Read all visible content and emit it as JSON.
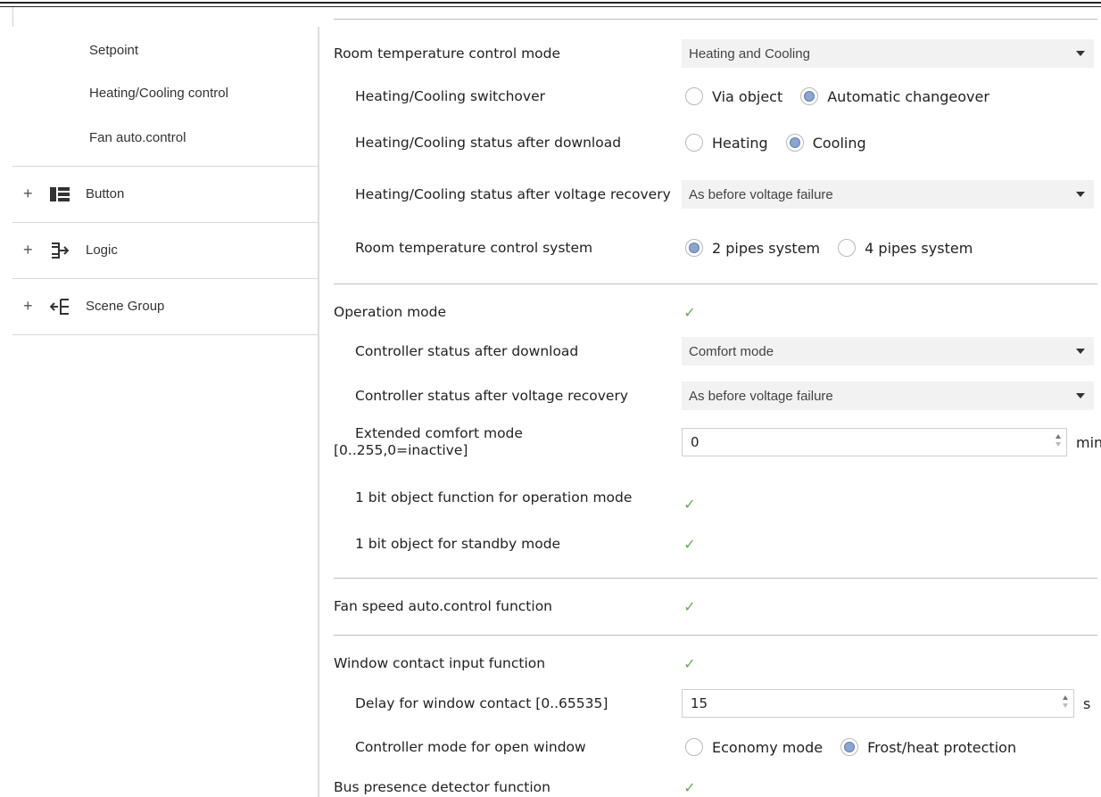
{
  "sidebar": {
    "sub_items": [
      "Setpoint",
      "Heating/Cooling control",
      "Fan auto.control"
    ],
    "groups": [
      {
        "label": "Button",
        "expander": "+",
        "icon": "button-icon"
      },
      {
        "label": "Logic",
        "expander": "+",
        "icon": "logic-icon"
      },
      {
        "label": "Scene Group",
        "expander": "+",
        "icon": "scene-group-icon"
      }
    ]
  },
  "main": {
    "room_mode": {
      "label": "Room temperature control mode",
      "value": "Heating and Cooling"
    },
    "switchover": {
      "label": "Heating/Cooling switchover",
      "opt1": "Via object",
      "opt2": "Automatic changeover",
      "selected": 2
    },
    "status_download": {
      "label": "Heating/Cooling status after download",
      "opt1": "Heating",
      "opt2": "Cooling",
      "selected": 2
    },
    "status_voltage": {
      "label": "Heating/Cooling status after voltage recovery",
      "value": "As before voltage failure"
    },
    "control_system": {
      "label": "Room temperature control system",
      "opt1": "2 pipes system",
      "opt2": "4 pipes system",
      "selected": 1
    },
    "operation_mode": {
      "label": "Operation mode",
      "checked": true
    },
    "ctrl_download": {
      "label": "Controller status after download",
      "value": "Comfort mode"
    },
    "ctrl_voltage": {
      "label": "Controller status after voltage recovery",
      "value": "As before voltage failure"
    },
    "extended_comfort": {
      "label": "Extended comfort mode [0..255,0=inactive]",
      "value": "0",
      "unit": "min"
    },
    "one_bit_op": {
      "label": "1 bit object function for operation mode",
      "checked": true
    },
    "one_bit_standby": {
      "label": "1 bit object for standby mode",
      "checked": true
    },
    "fan_speed": {
      "label": "Fan speed auto.control function",
      "checked": true
    },
    "window_contact": {
      "label": "Window contact input function",
      "checked": true
    },
    "window_delay": {
      "label": "Delay for window contact [0..65535]",
      "value": "15",
      "unit": "s"
    },
    "open_window": {
      "label": "Controller mode for open window",
      "opt1": "Economy mode",
      "opt2": "Frost/heat protection",
      "selected": 2
    },
    "bus_presence": {
      "label": "Bus presence detector function",
      "checked": true
    },
    "checkmark": "✓"
  }
}
